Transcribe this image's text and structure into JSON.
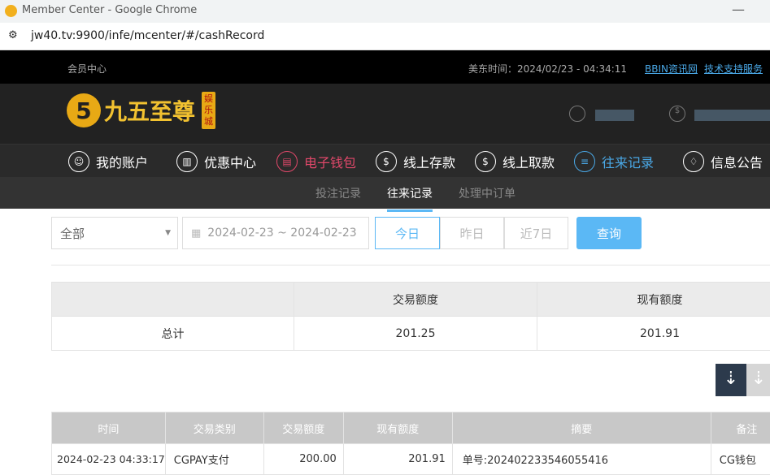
{
  "window": {
    "title": "Member Center - Google Chrome",
    "url": "jw40.tv:9900/infe/mcenter/#/cashRecord"
  },
  "topbar": {
    "member_center": "会员中心",
    "time_label": "美东时间：",
    "time_value": "2024/02/23 - 04:34:11",
    "link_bbin": "BBIN资讯网",
    "link_support": "技术支持服务"
  },
  "logo": {
    "text": "九五至尊",
    "badge": "娱乐城"
  },
  "nav": [
    {
      "label": "我的账户",
      "icon": "user-icon"
    },
    {
      "label": "优惠中心",
      "icon": "gift-icon"
    },
    {
      "label": "电子钱包",
      "icon": "wallet-icon"
    },
    {
      "label": "线上存款",
      "icon": "deposit-icon"
    },
    {
      "label": "线上取款",
      "icon": "withdraw-icon"
    },
    {
      "label": "往来记录",
      "icon": "record-icon"
    },
    {
      "label": "信息公告",
      "icon": "bell-icon"
    }
  ],
  "subnav": [
    "投注记录",
    "往来记录",
    "处理中订单"
  ],
  "filter": {
    "type": "全部",
    "date_range": "2024-02-23 ~ 2024-02-23",
    "today": "今日",
    "yesterday": "昨日",
    "last7": "近7日",
    "query": "查询"
  },
  "summary": {
    "headers": [
      "",
      "交易额度",
      "现有额度"
    ],
    "row": [
      "总计",
      "201.25",
      "201.91"
    ]
  },
  "table": {
    "headers": [
      "时间",
      "交易类别",
      "交易额度",
      "现有额度",
      "摘要",
      "备注"
    ],
    "rows": [
      [
        "2024-02-23 04:33:17",
        "CGPAY支付",
        "200.00",
        "201.91",
        "单号:202402233546055416",
        "CG钱包"
      ]
    ]
  },
  "colors": {
    "accent": "#5bb8f5",
    "active_nav": "#4aa8e6",
    "wallet": "#e0486a"
  }
}
